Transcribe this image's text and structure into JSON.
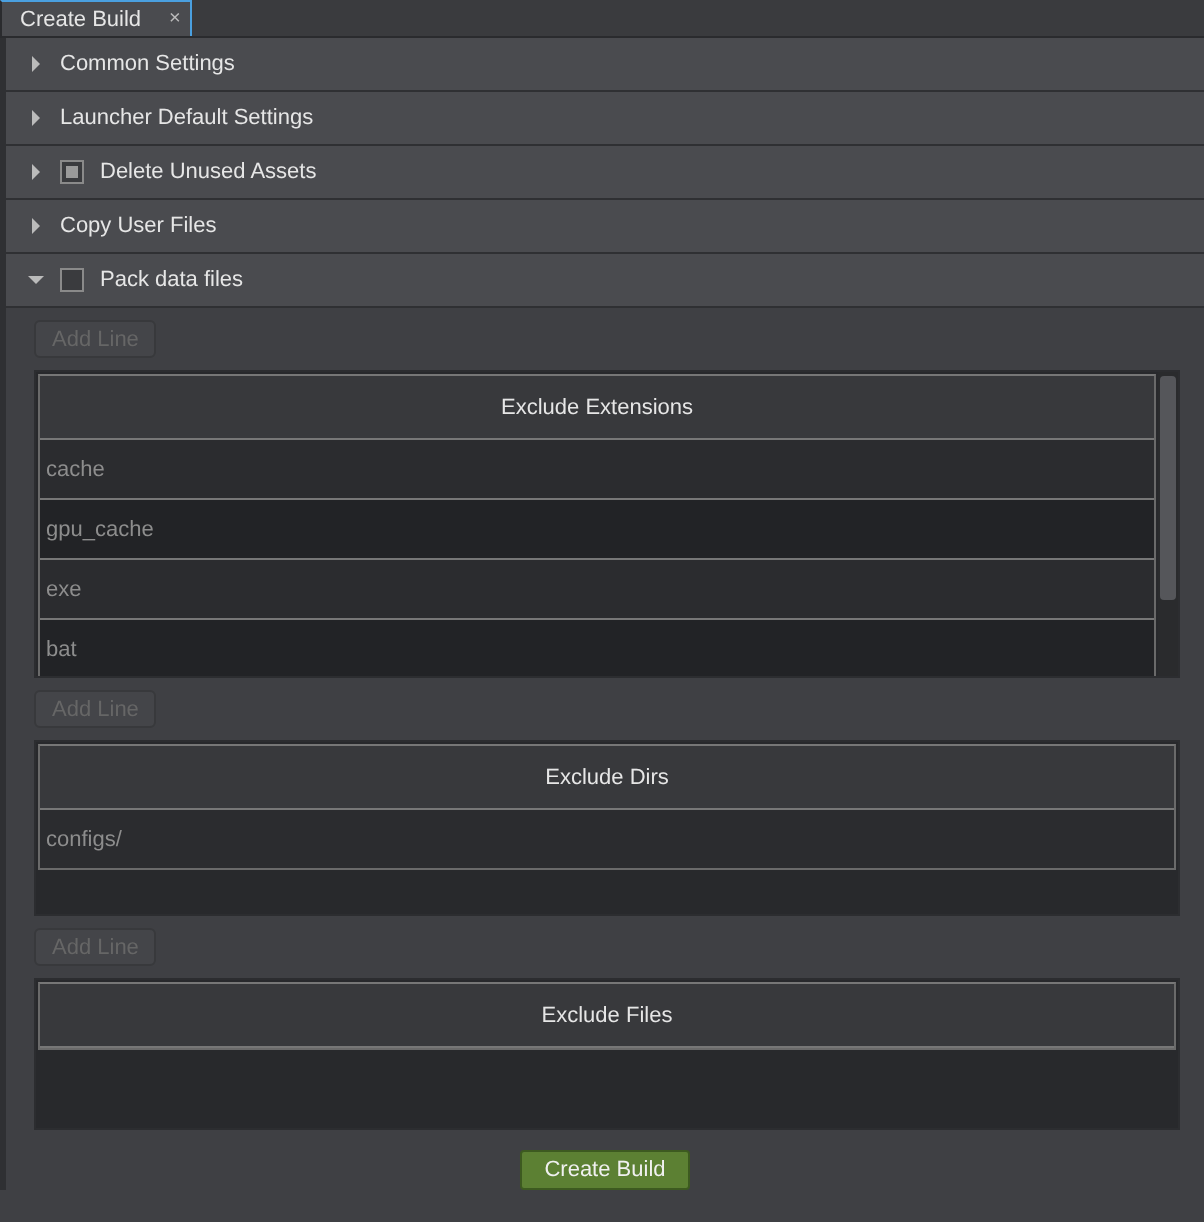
{
  "tabs": [
    {
      "label": "Create Build",
      "close": "×",
      "selected": true
    }
  ],
  "sections": [
    {
      "title": "Common Settings",
      "expanded": false
    },
    {
      "title": "Launcher Default Settings",
      "expanded": false
    },
    {
      "title": "Delete Unused Assets",
      "expanded": false,
      "checkbox": {
        "checked": false,
        "partial": true
      }
    },
    {
      "title": "Copy User Files",
      "expanded": false
    },
    {
      "title": "Pack data files",
      "expanded": true,
      "checkbox": {
        "checked": false,
        "partial": false
      }
    }
  ],
  "lists": [
    {
      "add_button": {
        "label": "Add Line",
        "disabled": true
      },
      "column": "Exclude Extensions",
      "rows": [
        "cache",
        "gpu_cache",
        "exe",
        "bat"
      ],
      "scrollbar": true
    },
    {
      "add_button": {
        "label": "Add Line",
        "disabled": true
      },
      "column": "Exclude Dirs",
      "rows": [
        "configs/"
      ],
      "scrollbar": false
    },
    {
      "add_button": {
        "label": "Add Line",
        "disabled": true
      },
      "column": "Exclude Files",
      "scrollbar": false
    }
  ],
  "create_button": {
    "label": "Create Build"
  }
}
